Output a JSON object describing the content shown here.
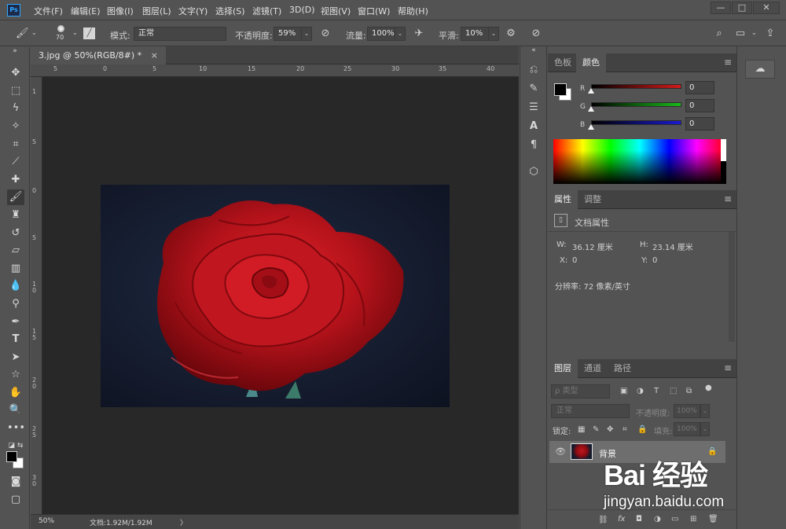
{
  "app": {
    "logo": "Ps"
  },
  "menu": [
    "文件(F)",
    "编辑(E)",
    "图像(I)",
    "图层(L)",
    "文字(Y)",
    "选择(S)",
    "滤镜(T)",
    "3D(D)",
    "视图(V)",
    "窗口(W)",
    "帮助(H)"
  ],
  "window_buttons": {
    "minimize": "—",
    "maximize": "□",
    "close": "✕"
  },
  "options": {
    "brush_size": "70",
    "mode_label": "模式:",
    "mode_value": "正常",
    "opacity_label": "不透明度:",
    "opacity_value": "59%",
    "flow_label": "流量:",
    "flow_value": "100%",
    "smoothing_label": "平滑:",
    "smoothing_value": "10%"
  },
  "document": {
    "tab_title": "3.jpg @ 50%(RGB/8#) *",
    "close": "×",
    "zoom": "50%",
    "doc_info": "文档:1.92M/1.92M",
    "status_arrow": "〉"
  },
  "rulers": {
    "h": [
      "5",
      "0",
      "5",
      "10",
      "15",
      "20",
      "25",
      "30",
      "35",
      "40"
    ],
    "v": [
      "1",
      "5",
      "0",
      "5",
      "1 0",
      "1 5",
      "2 0",
      "2 5",
      "3 0"
    ]
  },
  "color_panel": {
    "tabs": [
      "色板",
      "颜色"
    ],
    "active_tab": 1,
    "channels": [
      {
        "label": "R",
        "value": "0",
        "color": "#d11a1a"
      },
      {
        "label": "G",
        "value": "0",
        "color": "#1ab81a"
      },
      {
        "label": "B",
        "value": "0",
        "color": "#1a1ad1"
      }
    ],
    "foreground": "#000000",
    "background": "#ffffff"
  },
  "properties_panel": {
    "tabs": [
      "属性",
      "调整"
    ],
    "active_tab": 0,
    "title": "文档属性",
    "w_label": "W:",
    "w_value": "36.12 厘米",
    "h_label": "H:",
    "h_value": "23.14 厘米",
    "x_label": "X:",
    "x_value": "0",
    "y_label": "Y:",
    "y_value": "0",
    "resolution": "分辨率: 72 像素/英寸"
  },
  "layers_panel": {
    "tabs": [
      "图层",
      "通道",
      "路径"
    ],
    "active_tab": 0,
    "filter_kind": "ρ 类型",
    "blend_mode": "正常",
    "opacity_label": "不透明度:",
    "opacity_value": "100%",
    "lock_label": "锁定:",
    "fill_label": "填充:",
    "fill_value": "100%",
    "layers": [
      {
        "name": "背景",
        "locked": true,
        "visible": true
      }
    ],
    "bottom_icons": [
      "link-icon",
      "fx-icon",
      "mask-icon",
      "adjustment-icon",
      "group-icon",
      "new-layer-icon",
      "trash-icon"
    ],
    "fx_text": "fx"
  },
  "watermark": {
    "logo": "Bai 经验",
    "url": "jingyan.baidu.com"
  }
}
